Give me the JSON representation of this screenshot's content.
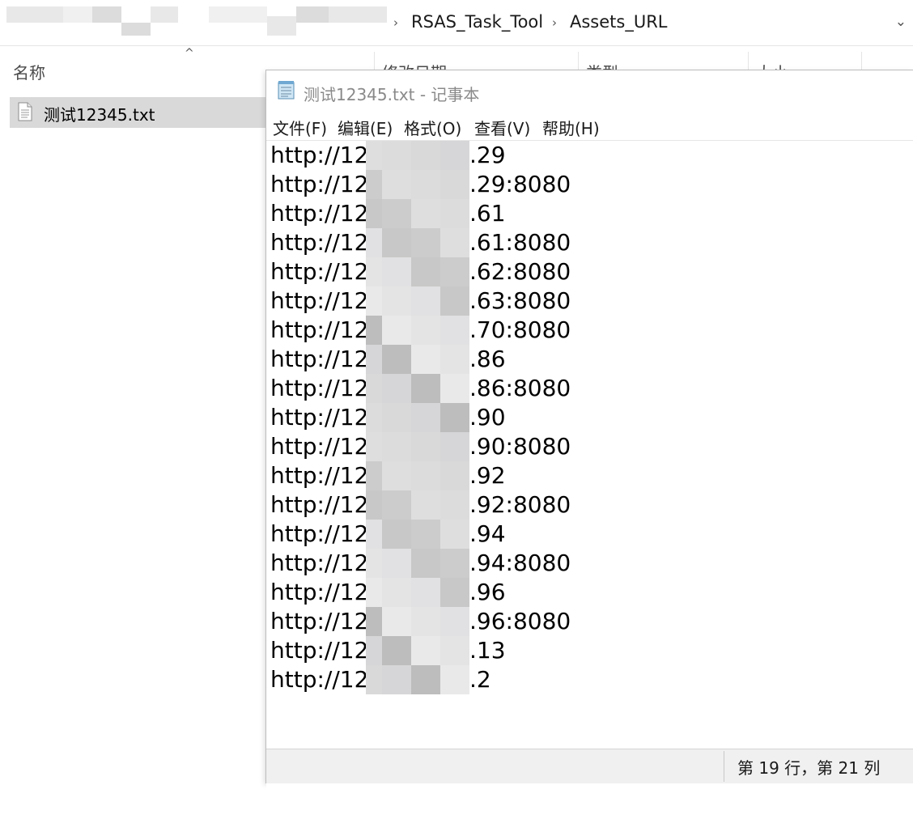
{
  "explorer": {
    "breadcrumb": [
      "RSAS_Task_Tool",
      "Assets_URL"
    ],
    "columns": {
      "name": "名称",
      "modified": "修改日期",
      "type": "类型",
      "size": "大小"
    },
    "file": {
      "name": "测试12345.txt"
    }
  },
  "notepad": {
    "title": "测试12345.txt - 记事本",
    "menu": [
      "文件(F)",
      "编辑(E)",
      "格式(O)",
      "查看(V)",
      "帮助(H)"
    ],
    "lines": [
      {
        "prefix": "http://12",
        "suffix": ".29"
      },
      {
        "prefix": "http://12",
        "suffix": ".29:8080"
      },
      {
        "prefix": "http://12",
        "suffix": ".61"
      },
      {
        "prefix": "http://12",
        "suffix": ".61:8080"
      },
      {
        "prefix": "http://12",
        "suffix": ".62:8080"
      },
      {
        "prefix": "http://12",
        "suffix": ".63:8080"
      },
      {
        "prefix": "http://12",
        "suffix": ".70:8080"
      },
      {
        "prefix": "http://12",
        "suffix": ".86"
      },
      {
        "prefix": "http://12",
        "suffix": ".86:8080"
      },
      {
        "prefix": "http://12",
        "suffix": ".90"
      },
      {
        "prefix": "http://12",
        "suffix": ".90:8080"
      },
      {
        "prefix": "http://12",
        "suffix": ".92"
      },
      {
        "prefix": "http://12",
        "suffix": ".92:8080"
      },
      {
        "prefix": "http://12",
        "suffix": ".94"
      },
      {
        "prefix": "http://12",
        "suffix": ".94:8080"
      },
      {
        "prefix": "http://12",
        "suffix": ".96"
      },
      {
        "prefix": "http://12",
        "suffix": ".96:8080"
      },
      {
        "prefix": "http://12",
        "suffix": ".13"
      },
      {
        "prefix": "http://12",
        "suffix": ".2"
      }
    ],
    "status": "第 19 行，第 21 列"
  },
  "icons": {
    "breadcrumb_separator": "chevron-right-icon",
    "address_dropdown": "chevron-down-icon",
    "sort": "sort-up-icon",
    "file": "text-file-icon",
    "app": "notepad-icon"
  }
}
